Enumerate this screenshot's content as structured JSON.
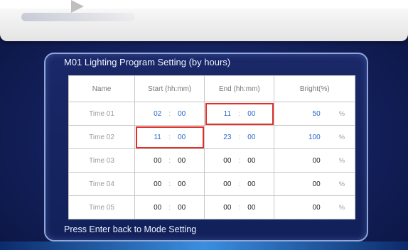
{
  "title": "M01 Lighting Program Setting (by hours)",
  "columns": {
    "name": "Name",
    "start": "Start (hh:mm)",
    "end": "End (hh:mm)",
    "bright": "Bright(%)"
  },
  "rows": [
    {
      "name": "Time 01",
      "start_h": "02",
      "start_m": "00",
      "end_h": "11",
      "end_m": "00",
      "bright": "50",
      "pct": "%"
    },
    {
      "name": "Time 02",
      "start_h": "11",
      "start_m": "00",
      "end_h": "23",
      "end_m": "00",
      "bright": "100",
      "pct": "%"
    },
    {
      "name": "Time 03",
      "start_h": "00",
      "start_m": "00",
      "end_h": "00",
      "end_m": "00",
      "bright": "00",
      "pct": "%"
    },
    {
      "name": "Time 04",
      "start_h": "00",
      "start_m": "00",
      "end_h": "00",
      "end_m": "00",
      "bright": "00",
      "pct": "%"
    },
    {
      "name": "Time 05",
      "start_h": "00",
      "start_m": "00",
      "end_h": "00",
      "end_m": "00",
      "bright": "00",
      "pct": "%"
    }
  ],
  "separator": ":",
  "footer": "Press Enter back to Mode Setting",
  "colors": {
    "value_active": "#2a66c8",
    "value_default": "#222222",
    "highlight": "#e0302a",
    "panel_border": "#8fa6d6"
  }
}
